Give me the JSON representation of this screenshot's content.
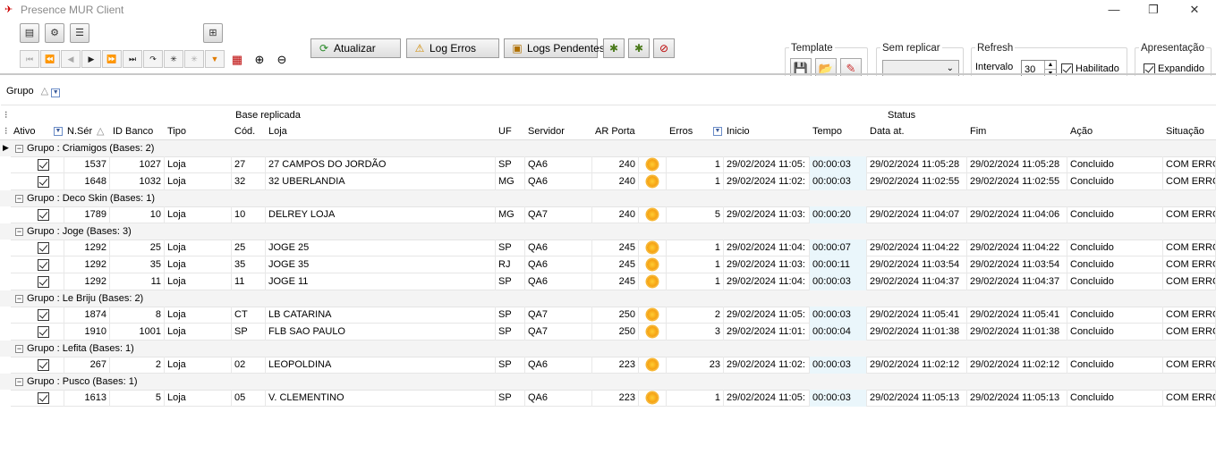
{
  "window": {
    "title": "Presence MUR Client",
    "minimize": "—",
    "restore": "❐",
    "close": "✕"
  },
  "toolbar": {
    "atualizar_label": "Atualizar",
    "log_erros_label": "Log Erros",
    "logs_pendentes_label": "Logs Pendentes"
  },
  "template": {
    "label": "Template"
  },
  "sem_replicar": {
    "label": "Sem replicar",
    "value": ""
  },
  "refresh": {
    "label": "Refresh",
    "intervalo_label": "Intervalo",
    "intervalo_value": "30",
    "habilitado_label": "Habilitado"
  },
  "apresentacao": {
    "label": "Apresentação",
    "expandido_label": "Expandido"
  },
  "group_panel": {
    "chip_label": "Grupo"
  },
  "grid": {
    "band_base": "Base replicada",
    "band_status": "Status",
    "columns": [
      "Ativo",
      "N.Sér",
      "ID Banco",
      "Tipo",
      "Cód.",
      "Loja",
      "UF",
      "Servidor",
      "AR Porta",
      "",
      "Erros",
      "Inicio",
      "Tempo",
      "Data at.",
      "Fim",
      "Ação",
      "Situação"
    ],
    "groups": [
      {
        "label": "Grupo  : Criamigos (Bases: 2)",
        "rows": [
          {
            "nser": "1537",
            "idbanco": "1027",
            "tipo": "Loja",
            "cod": "27",
            "loja": "27 CAMPOS DO JORDÃO",
            "uf": "SP",
            "servidor": "QA6",
            "porta": "240",
            "erros": "1",
            "inicio": "29/02/2024 11:05:",
            "tempo": "00:00:03",
            "data": "29/02/2024 11:05:28",
            "fim": "29/02/2024 11:05:28",
            "acao": "Concluido",
            "situacao": "COM ERRO"
          },
          {
            "nser": "1648",
            "idbanco": "1032",
            "tipo": "Loja",
            "cod": "32",
            "loja": "32 UBERLANDIA",
            "uf": "MG",
            "servidor": "QA6",
            "porta": "240",
            "erros": "1",
            "inicio": "29/02/2024 11:02:",
            "tempo": "00:00:03",
            "data": "29/02/2024 11:02:55",
            "fim": "29/02/2024 11:02:55",
            "acao": "Concluido",
            "situacao": "COM ERRO"
          }
        ]
      },
      {
        "label": "Grupo  : Deco Skin (Bases: 1)",
        "rows": [
          {
            "nser": "1789",
            "idbanco": "10",
            "tipo": "Loja",
            "cod": "10",
            "loja": "DELREY LOJA",
            "uf": "MG",
            "servidor": "QA7",
            "porta": "240",
            "erros": "5",
            "inicio": "29/02/2024 11:03:",
            "tempo": "00:00:20",
            "data": "29/02/2024 11:04:07",
            "fim": "29/02/2024 11:04:06",
            "acao": "Concluido",
            "situacao": "COM ERRO"
          }
        ]
      },
      {
        "label": "Grupo  : Joge (Bases: 3)",
        "rows": [
          {
            "nser": "1292",
            "idbanco": "25",
            "tipo": "Loja",
            "cod": "25",
            "loja": "JOGE 25",
            "uf": "SP",
            "servidor": "QA6",
            "porta": "245",
            "erros": "1",
            "inicio": "29/02/2024 11:04:",
            "tempo": "00:00:07",
            "data": "29/02/2024 11:04:22",
            "fim": "29/02/2024 11:04:22",
            "acao": "Concluido",
            "situacao": "COM ERRO"
          },
          {
            "nser": "1292",
            "idbanco": "35",
            "tipo": "Loja",
            "cod": "35",
            "loja": "JOGE 35",
            "uf": "RJ",
            "servidor": "QA6",
            "porta": "245",
            "erros": "1",
            "inicio": "29/02/2024 11:03:",
            "tempo": "00:00:11",
            "data": "29/02/2024 11:03:54",
            "fim": "29/02/2024 11:03:54",
            "acao": "Concluido",
            "situacao": "COM ERRO"
          },
          {
            "nser": "1292",
            "idbanco": "11",
            "tipo": "Loja",
            "cod": "11",
            "loja": "JOGE 11",
            "uf": "SP",
            "servidor": "QA6",
            "porta": "245",
            "erros": "1",
            "inicio": "29/02/2024 11:04:",
            "tempo": "00:00:03",
            "data": "29/02/2024 11:04:37",
            "fim": "29/02/2024 11:04:37",
            "acao": "Concluido",
            "situacao": "COM ERRO"
          }
        ]
      },
      {
        "label": "Grupo  : Le Briju (Bases: 2)",
        "rows": [
          {
            "nser": "1874",
            "idbanco": "8",
            "tipo": "Loja",
            "cod": "CT",
            "loja": "LB CATARINA",
            "uf": "SP",
            "servidor": "QA7",
            "porta": "250",
            "erros": "2",
            "inicio": "29/02/2024 11:05:",
            "tempo": "00:00:03",
            "data": "29/02/2024 11:05:41",
            "fim": "29/02/2024 11:05:41",
            "acao": "Concluido",
            "situacao": "COM ERRO"
          },
          {
            "nser": "1910",
            "idbanco": "1001",
            "tipo": "Loja",
            "cod": "SP",
            "loja": "FLB SAO PAULO",
            "uf": "SP",
            "servidor": "QA7",
            "porta": "250",
            "erros": "3",
            "inicio": "29/02/2024 11:01:",
            "tempo": "00:00:04",
            "data": "29/02/2024 11:01:38",
            "fim": "29/02/2024 11:01:38",
            "acao": "Concluido",
            "situacao": "COM ERRO"
          }
        ]
      },
      {
        "label": "Grupo  : Lefita (Bases: 1)",
        "rows": [
          {
            "nser": "267",
            "idbanco": "2",
            "tipo": "Loja",
            "cod": "02",
            "loja": "LEOPOLDINA",
            "uf": "SP",
            "servidor": "QA6",
            "porta": "223",
            "erros": "23",
            "inicio": "29/02/2024 11:02:",
            "tempo": "00:00:03",
            "data": "29/02/2024 11:02:12",
            "fim": "29/02/2024 11:02:12",
            "acao": "Concluido",
            "situacao": "COM ERRO"
          }
        ]
      },
      {
        "label": "Grupo  : Pusco (Bases: 1)",
        "rows": [
          {
            "nser": "1613",
            "idbanco": "5",
            "tipo": "Loja",
            "cod": "05",
            "loja": "V. CLEMENTINO",
            "uf": "SP",
            "servidor": "QA6",
            "porta": "223",
            "erros": "1",
            "inicio": "29/02/2024 11:05:",
            "tempo": "00:00:03",
            "data": "29/02/2024 11:05:13",
            "fim": "29/02/2024 11:05:13",
            "acao": "Concluido",
            "situacao": "COM ERRO"
          }
        ]
      }
    ]
  }
}
